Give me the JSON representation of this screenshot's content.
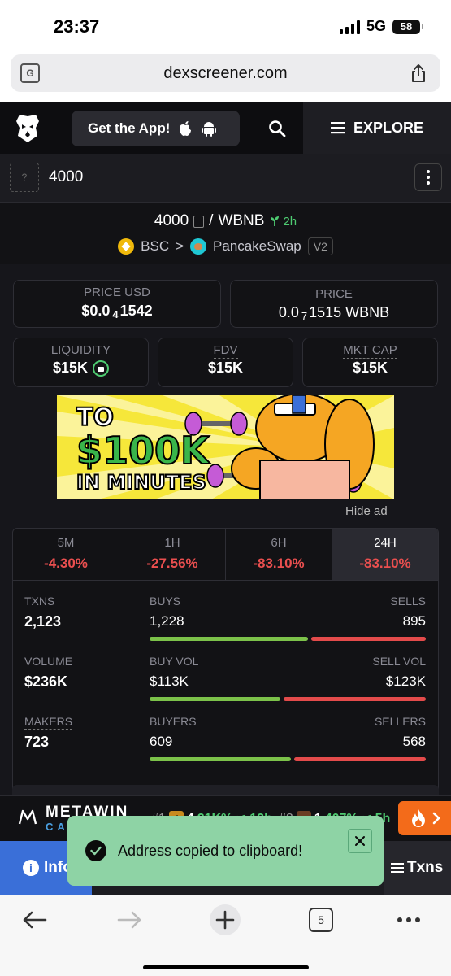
{
  "status_bar": {
    "time": "23:37",
    "network": "5G",
    "battery": "58"
  },
  "browser": {
    "url": "dexscreener.com",
    "tabs_count": "5"
  },
  "nav": {
    "get_app_label": "Get the App!",
    "explore_label": "EXPLORE"
  },
  "token": {
    "name": "4000",
    "placeholder": "?"
  },
  "pair": {
    "base": "4000",
    "separator": "/",
    "quote": "WBNB",
    "age": "2h",
    "chain": "BSC",
    "chevron": ">",
    "dex": "PancakeSwap",
    "version": "V2"
  },
  "prices": {
    "price_usd_label": "PRICE USD",
    "price_usd_prefix": "$0.0",
    "price_usd_sub": "4",
    "price_usd_suffix": "1542",
    "price_label": "PRICE",
    "price_prefix": "0.0",
    "price_sub": "7",
    "price_suffix": "1515 WBNB"
  },
  "metrics": {
    "liquidity_label": "LIQUIDITY",
    "liquidity_value": "$15K",
    "fdv_label": "FDV",
    "fdv_value": "$15K",
    "mktcap_label": "MKT CAP",
    "mktcap_value": "$15K"
  },
  "ad": {
    "line1": "TO",
    "line2": "$100K",
    "line3": "IN MINUTES",
    "hide_label": "Hide ad"
  },
  "timeframes": [
    {
      "label": "5M",
      "change": "-4.30%"
    },
    {
      "label": "1H",
      "change": "-27.56%"
    },
    {
      "label": "6H",
      "change": "-83.10%"
    },
    {
      "label": "24H",
      "change": "-83.10%"
    }
  ],
  "stats": {
    "txns_label": "TXNS",
    "txns": "2,123",
    "buys_label": "BUYS",
    "buys": "1,228",
    "sells_label": "SELLS",
    "sells": "895",
    "buys_share": 0.578,
    "volume_label": "VOLUME",
    "volume": "$236K",
    "buy_vol_label": "BUY VOL",
    "buy_vol": "$113K",
    "sell_vol_label": "SELL VOL",
    "sell_vol": "$123K",
    "buy_vol_share": 0.479,
    "makers_label": "MAKERS",
    "makers": "723",
    "buyers_label": "BUYERS",
    "buyers": "609",
    "sellers_label": "SELLERS",
    "sellers": "568",
    "buyers_share": 0.517
  },
  "ticker": {
    "brand": "METAWIN",
    "brand_sub": "CASINO",
    "items": [
      {
        "rank": "#1",
        "badge": "4",
        "name": "4",
        "pct": "21K%",
        "age": "12h"
      },
      {
        "rank": "#2",
        "name": "1",
        "pct": "407%",
        "age": "5h"
      }
    ]
  },
  "bottom_tabs": {
    "info_label": "Info",
    "txns_label": "Txns"
  },
  "toast": {
    "message": "Address copied to clipboard!"
  },
  "colors": {
    "green": "#4ecb71",
    "red": "#ea4f4f",
    "toast_bg": "#8ed3a5",
    "info_tab": "#3a6fd8"
  }
}
